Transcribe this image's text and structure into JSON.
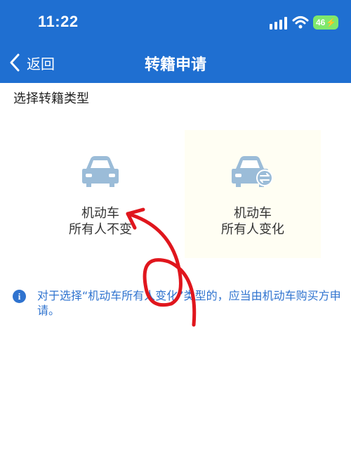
{
  "status_bar": {
    "time": "11:22",
    "battery": "46"
  },
  "header": {
    "back_label": "返回",
    "title": "转籍申请"
  },
  "section_label": "选择转籍类型",
  "options": [
    {
      "line1": "机动车",
      "line2": "所有人不变"
    },
    {
      "line1": "机动车",
      "line2": "所有人变化"
    }
  ],
  "info": {
    "text": "对于选择“机动车所有人变化”类型的，应当由机动车购买方申请。"
  },
  "colors": {
    "header": "#1f6fd1",
    "accent": "#2f73cf",
    "car_icon": "#9bbcd8",
    "annotation": "#e0161d"
  }
}
